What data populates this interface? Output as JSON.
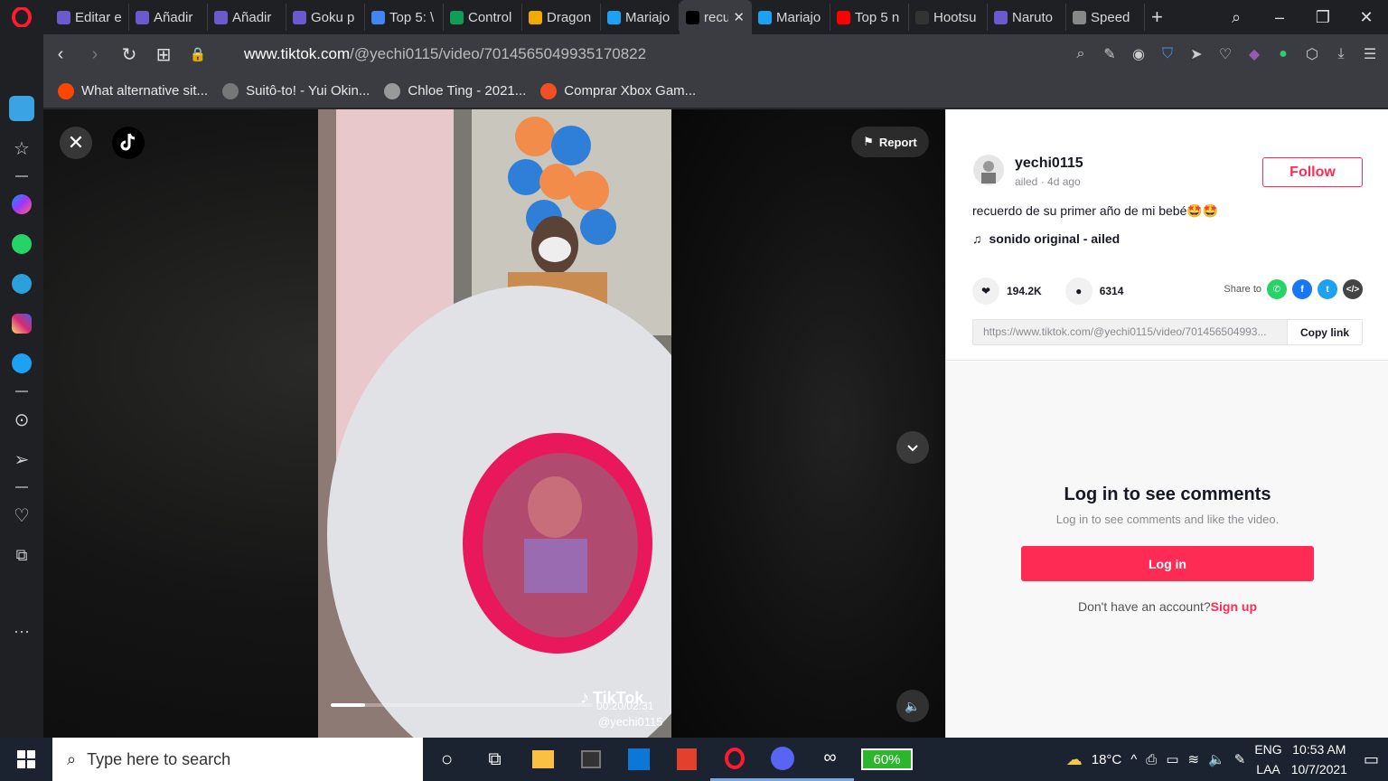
{
  "browser": {
    "tabs": [
      {
        "label": "Editar e",
        "icon": "edit-page-icon",
        "color": "#6a5acd"
      },
      {
        "label": "Añadir",
        "icon": "edit-page-icon",
        "color": "#6a5acd"
      },
      {
        "label": "Añadir",
        "icon": "edit-page-icon",
        "color": "#6a5acd"
      },
      {
        "label": "Goku p",
        "icon": "edit-page-icon",
        "color": "#6a5acd"
      },
      {
        "label": "Top 5: \\",
        "icon": "docs-icon",
        "color": "#4285f4"
      },
      {
        "label": "Control",
        "icon": "sheets-icon",
        "color": "#0f9d58"
      },
      {
        "label": "Dragon",
        "icon": "cb-icon",
        "color": "#f2a900"
      },
      {
        "label": "Mariajo",
        "icon": "twitter-icon",
        "color": "#1da1f2"
      },
      {
        "label": "recu",
        "icon": "tiktok-icon",
        "color": "#000000"
      },
      {
        "label": "Mariajo",
        "icon": "twitter-icon",
        "color": "#1da1f2"
      },
      {
        "label": "Top 5 n",
        "icon": "youtube-icon",
        "color": "#ff0000"
      },
      {
        "label": "Hootsu",
        "icon": "hootsuite-icon",
        "color": "#333333"
      },
      {
        "label": "Naruto",
        "icon": "edit-page-icon",
        "color": "#6a5acd"
      },
      {
        "label": "Speed",
        "icon": "speed-dial-icon",
        "color": "#888888"
      }
    ],
    "url_host": "www.tiktok.com",
    "url_path": "/@yechi0115/video/7014565049935170822",
    "bookmarks": [
      {
        "label": "What alternative sit...",
        "color": "#ff4500"
      },
      {
        "label": "Suitô-to! - Yui Okin...",
        "color": "#777777"
      },
      {
        "label": "Chloe Ting - 2021...",
        "color": "#999999"
      },
      {
        "label": "Comprar Xbox Gam...",
        "color": "#f25022"
      }
    ]
  },
  "video": {
    "report_label": "Report",
    "time": "00:20/02:31",
    "watermark": "TikTok",
    "watermark_user": "@yechi0115",
    "progress": 0.13
  },
  "panel": {
    "username": "yechi0115",
    "meta": "ailed · 4d ago",
    "follow_label": "Follow",
    "caption": "recuerdo de su primer año de mi bebé🤩🤩",
    "music": "sonido original - ailed",
    "likes": "194.2K",
    "comments": "6314",
    "share_label": "Share to",
    "link": "https://www.tiktok.com/@yechi0115/video/701456504993...",
    "copy_label": "Copy link",
    "comments_title": "Log in to see comments",
    "comments_sub": "Log in to see comments and like the video.",
    "login_label": "Log in",
    "signup_prefix": "Don't have an account?",
    "signup_link": "Sign up"
  },
  "taskbar": {
    "search_placeholder": "Type here to search",
    "battery": "60%",
    "weather": "18°C",
    "lang1": "ENG",
    "lang2": "LAA",
    "time": "10:53 AM",
    "date": "10/7/2021"
  }
}
